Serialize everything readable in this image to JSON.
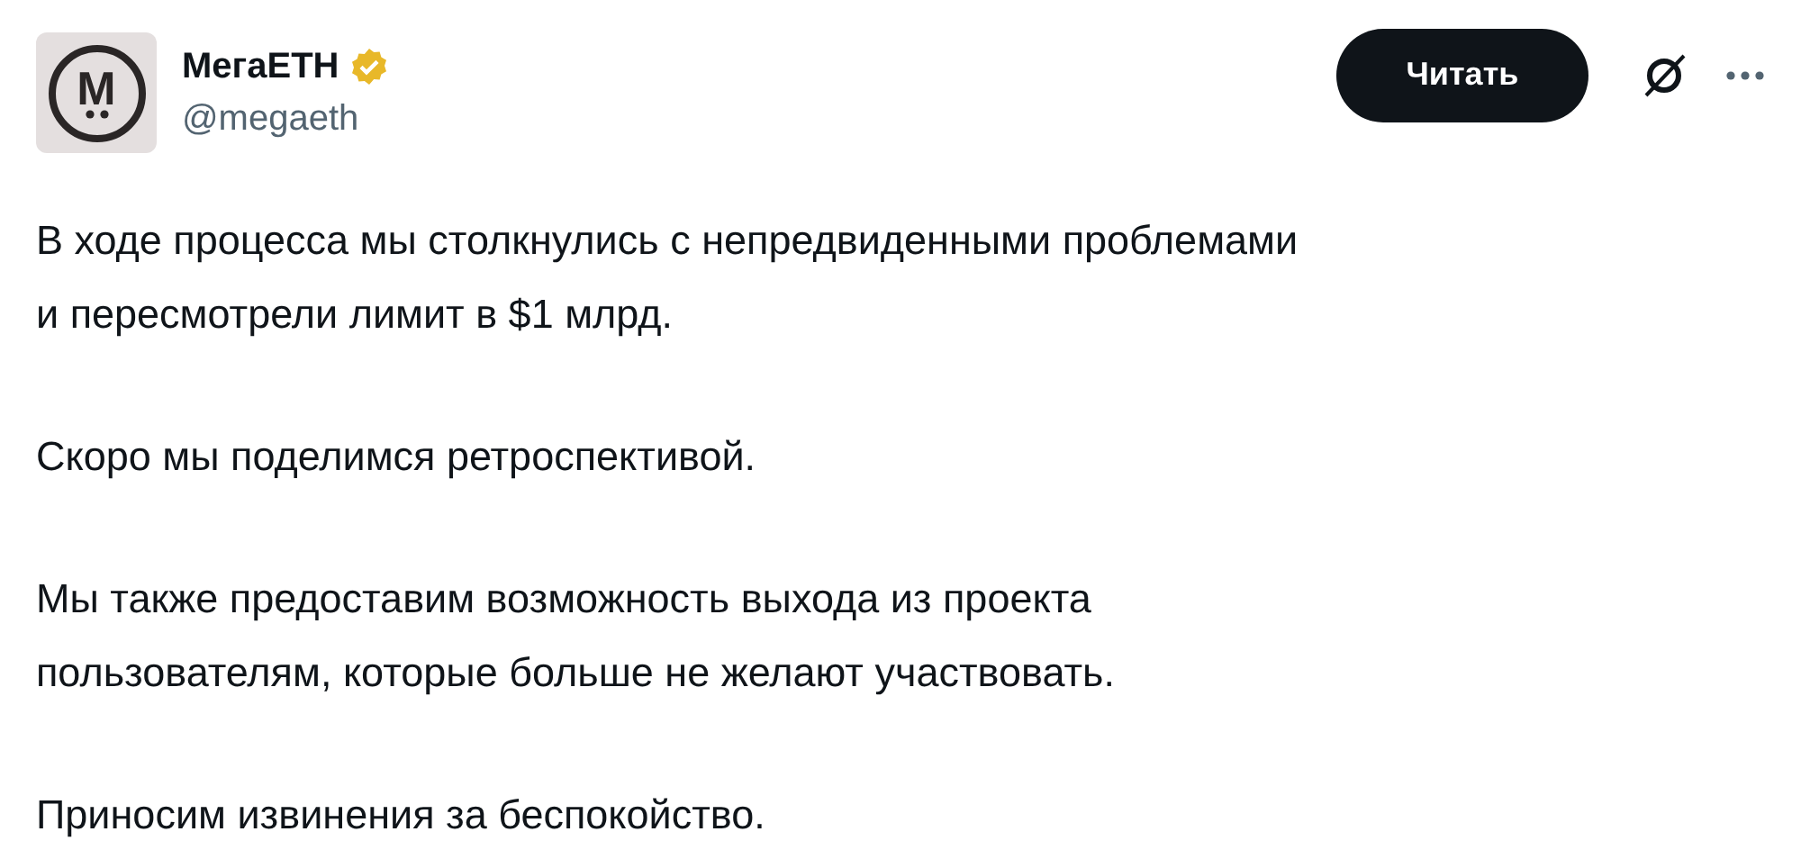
{
  "author": {
    "avatar_letter": "M",
    "name": "MегаETH",
    "verified": true,
    "handle": "@megaeth"
  },
  "follow_button": {
    "label": "Читать"
  },
  "paragraphs": [
    "В ходе процесса мы столкнулись с непредвиденными проблемами\nи пересмотрели лимит в $1 млрд.",
    "Скоро мы поделимся ретроспективой.",
    "Мы также предоставим возможность выхода из проекта\nпользователям, которые больше не желают участвовать.",
    "Приносим извинения за беспокойство."
  ]
}
